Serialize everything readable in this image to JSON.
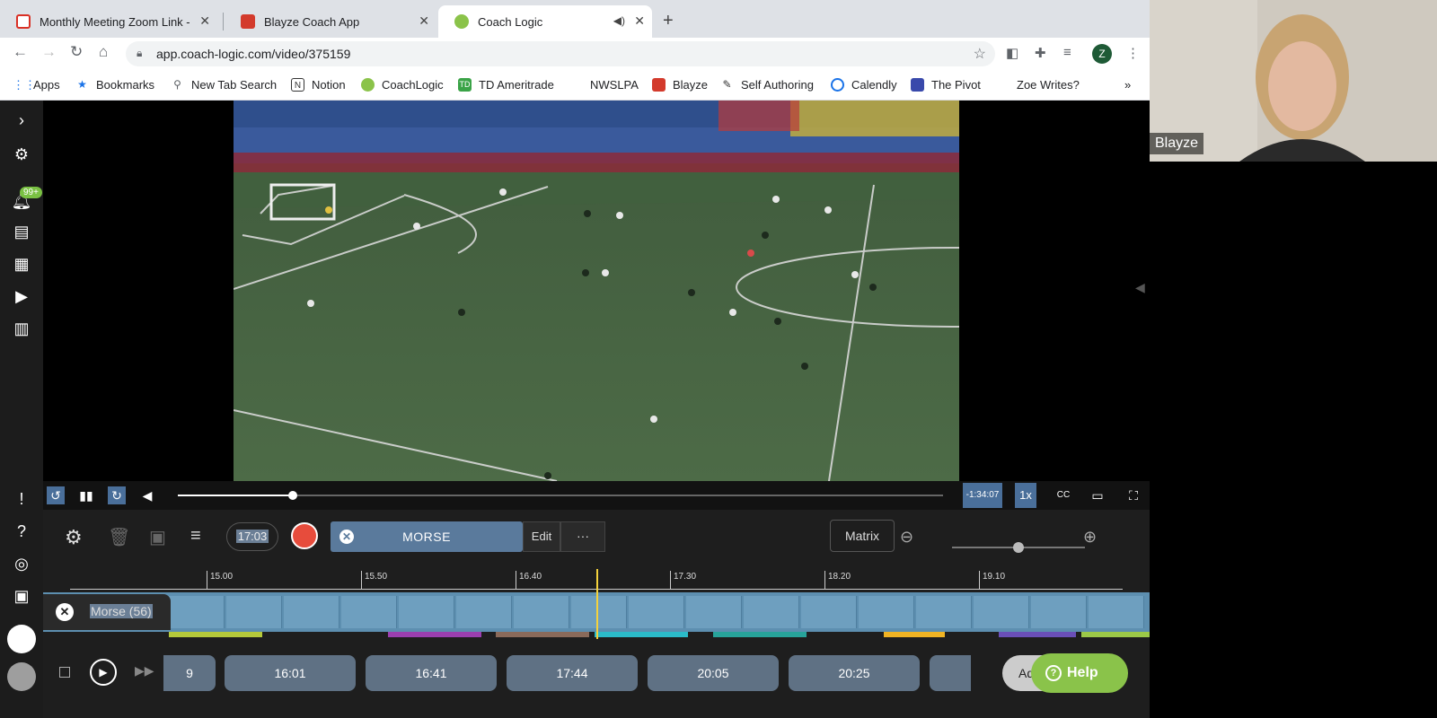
{
  "browser": {
    "tabs": [
      {
        "title": "Monthly Meeting Zoom Link -",
        "favicon_color": "#d93025"
      },
      {
        "title": "Blayze Coach App",
        "favicon_color": "#d33a2c"
      },
      {
        "title": "Coach Logic",
        "favicon_color": "#8bc34a"
      }
    ],
    "url": "app.coach-logic.com/video/375159",
    "profile_initial": "Z",
    "bookmarks": [
      {
        "label": "Apps",
        "icon": "apps-grid-icon"
      },
      {
        "label": "Bookmarks",
        "icon": "star-icon"
      },
      {
        "label": "New Tab Search",
        "icon": "search-icon"
      },
      {
        "label": "Notion",
        "icon": "notion-icon"
      },
      {
        "label": "CoachLogic",
        "icon": "coachlogic-icon"
      },
      {
        "label": "TD Ameritrade",
        "icon": "td-icon"
      },
      {
        "label": "NWSLPA",
        "icon": ""
      },
      {
        "label": "Blayze",
        "icon": "blayze-icon"
      },
      {
        "label": "Self Authoring",
        "icon": "pen-icon"
      },
      {
        "label": "Calendly",
        "icon": "calendly-icon"
      },
      {
        "label": "The Pivot",
        "icon": "pivot-icon"
      },
      {
        "label": "Zoe Writes?",
        "icon": ""
      }
    ],
    "bookmarks_overflow": "»"
  },
  "sidebar": {
    "notification_badge": "99+"
  },
  "player": {
    "remaining_time": "-1:34:07",
    "speed": "1x",
    "progress": 0.15
  },
  "toolbar": {
    "timecode": "17:03",
    "tag_name": "MORSE",
    "edit_label": "Edit",
    "more_label": "···",
    "matrix_label": "Matrix",
    "zoom_level": 0.5
  },
  "timeline": {
    "ticks": [
      "15.00",
      "15.50",
      "16.40",
      "17.30",
      "18.20",
      "19.10"
    ],
    "playlist_label": "Morse (56)",
    "clips": [
      "9",
      "16:01",
      "16:41",
      "17:44",
      "20:05",
      "20:25",
      ""
    ],
    "add_label": "Ad",
    "help_label": "Help",
    "segment_colors": [
      "#b5c93a",
      "#9b3fb0",
      "#8a6a5a",
      "#2bbbc9",
      "#27a39a",
      "#f0b323",
      "#6a4fb8",
      "#9cc948"
    ]
  },
  "webcam": {
    "name": "Blayze"
  }
}
